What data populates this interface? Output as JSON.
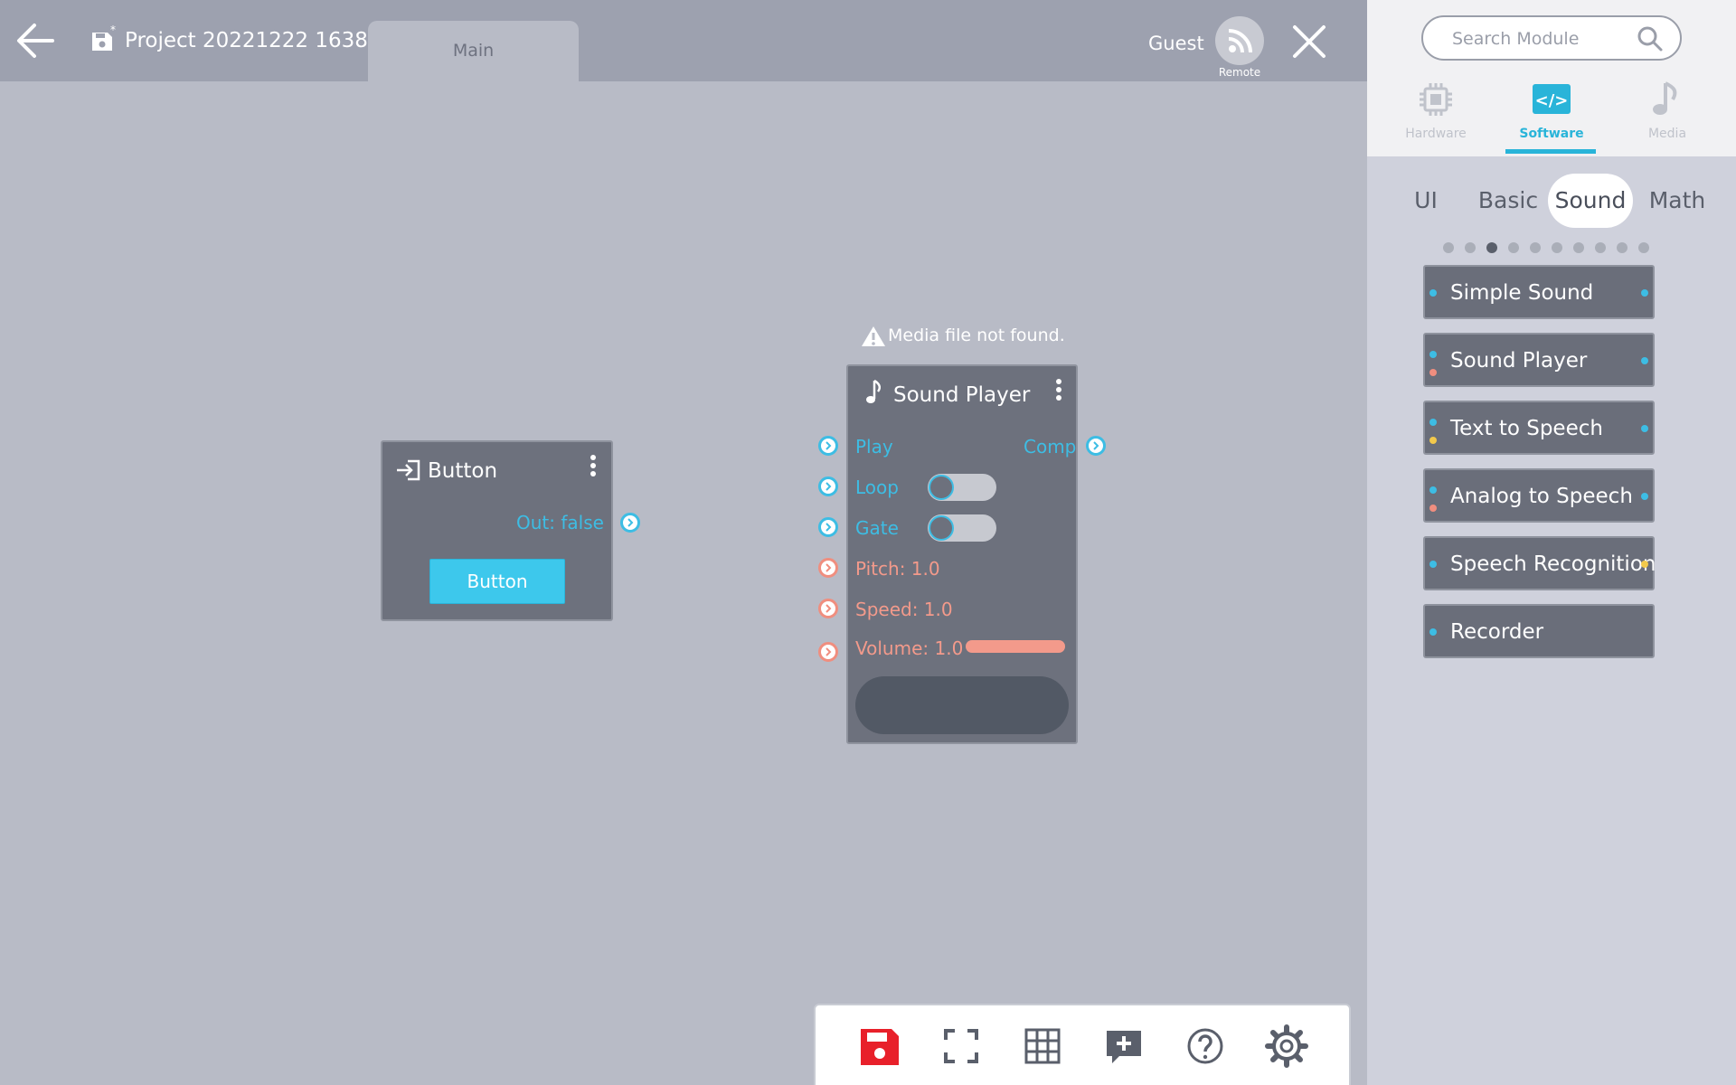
{
  "header": {
    "project_title": "Project 20221222 1638",
    "tabs": [
      {
        "label": "Main"
      }
    ],
    "user_label": "Guest",
    "remote_label": "Remote"
  },
  "panel": {
    "search": {
      "placeholder": "Search Module",
      "value": ""
    },
    "categories": [
      {
        "label": "Hardware",
        "icon": "chip-icon",
        "active": false
      },
      {
        "label": "Software",
        "icon": "code-icon",
        "active": true
      },
      {
        "label": "Media",
        "icon": "music-note-icon",
        "active": false
      }
    ],
    "subtabs": [
      {
        "label": "UI",
        "active": false
      },
      {
        "label": "Basic",
        "active": false
      },
      {
        "label": "Sound",
        "active": true
      },
      {
        "label": "Math",
        "active": false
      }
    ],
    "pager": {
      "total": 10,
      "current": 3
    },
    "modules": [
      {
        "label": "Simple Sound"
      },
      {
        "label": "Sound Player"
      },
      {
        "label": "Text to Speech"
      },
      {
        "label": "Analog to Speech"
      },
      {
        "label": "Speech Recognition"
      },
      {
        "label": "Recorder"
      }
    ]
  },
  "canvas": {
    "button_node": {
      "title": "Button",
      "icon": "login-arrow-icon",
      "output_label": "Out: false",
      "button_label": "Button"
    },
    "sound_player_node": {
      "title": "Sound Player",
      "icon": "music-note-icon",
      "warning": "Media file not found.",
      "ports": {
        "play": "Play",
        "comp": "Comp",
        "loop": "Loop",
        "gate": "Gate",
        "pitch": "Pitch: 1.0",
        "speed": "Speed: 1.0",
        "volume": "Volume: 1.0"
      },
      "loop_on": false,
      "gate_on": false,
      "volume_fraction": 1.0
    }
  },
  "toolbar": {
    "tools": [
      "save-icon",
      "fullscreen-icon",
      "grid-icon",
      "add-comment-icon",
      "help-icon",
      "settings-icon"
    ]
  },
  "colors": {
    "accent": "#29b4d9",
    "port_blue": "#3dbde4",
    "port_red": "#f08e7f",
    "port_yellow": "#f2c94c",
    "save_red": "#e8202a",
    "node_bg": "#6d717d",
    "canvas_bg": "#b8bbc6"
  }
}
